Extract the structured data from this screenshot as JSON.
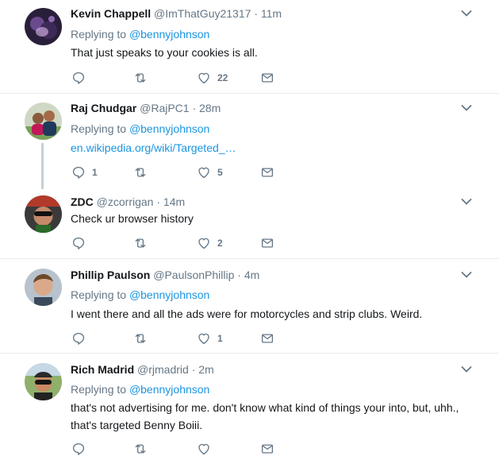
{
  "tweets": [
    {
      "name": "Kevin Chappell",
      "handle": "@ImThatGuy21317",
      "time": "11m",
      "reply_prefix": "Replying to",
      "reply_to": "@bennyjohnson",
      "text": "That just speaks to your cookies is all.",
      "replies": "",
      "retweets": "",
      "likes": "22"
    },
    {
      "name": "Raj Chudgar",
      "handle": "@RajPC1",
      "time": "28m",
      "reply_prefix": "Replying to",
      "reply_to": "@bennyjohnson",
      "text": "en.wikipedia.org/wiki/Targeted_…",
      "replies": "1",
      "retweets": "",
      "likes": "5"
    },
    {
      "name": "ZDC",
      "handle": "@zcorrigan",
      "time": "14m",
      "text": "Check ur browser history",
      "replies": "",
      "retweets": "",
      "likes": "2"
    },
    {
      "name": "Phillip Paulson",
      "handle": "@PaulsonPhillip",
      "time": "4m",
      "reply_prefix": "Replying to",
      "reply_to": "@bennyjohnson",
      "text": "I went there and all the ads were for motorcycles and strip clubs. Weird.",
      "replies": "",
      "retweets": "",
      "likes": "1"
    },
    {
      "name": "Rich Madrid",
      "handle": "@rjmadrid",
      "time": "2m",
      "reply_prefix": "Replying to",
      "reply_to": "@bennyjohnson",
      "text": "that's not advertising for me. don't know what kind of things your into, but, uhh., that's targeted Benny Boiii.",
      "replies": "",
      "retweets": "",
      "likes": ""
    }
  ],
  "separator": "·",
  "colors": {
    "text": "#14171a",
    "secondary": "#657786",
    "link": "#1b95e0",
    "divider": "#e6ecf0",
    "thread_line": "#c4cfd6"
  },
  "icons": [
    "reply-icon",
    "retweet-icon",
    "like-icon",
    "direct-message-icon",
    "chevron-down-icon"
  ]
}
